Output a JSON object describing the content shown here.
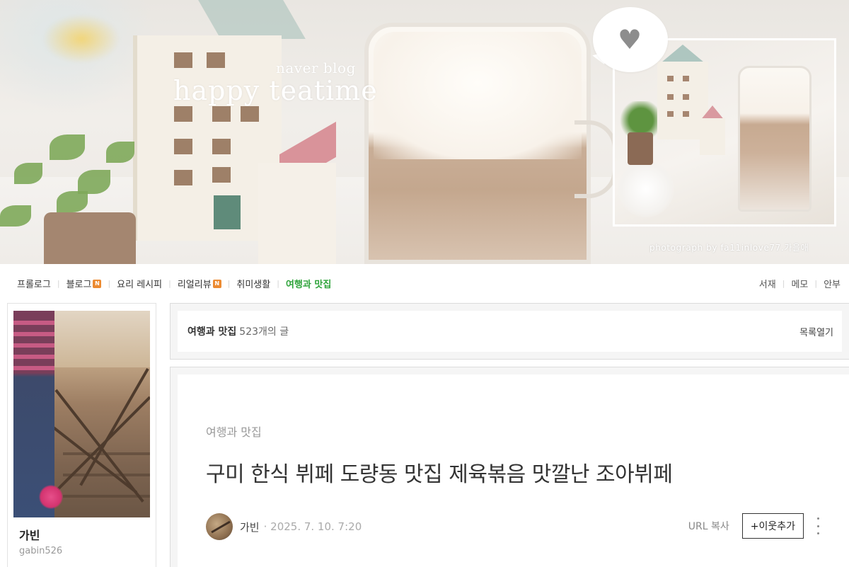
{
  "banner": {
    "subtitle": "naver blog",
    "title": "happy teatime",
    "credit": "photograph by fa11inlove77.가을애",
    "heart_icon": "heart-icon"
  },
  "menu": {
    "items": [
      {
        "label": "프롤로그",
        "badge": ""
      },
      {
        "label": "블로그",
        "badge": "N"
      },
      {
        "label": "요리 레시피",
        "badge": ""
      },
      {
        "label": "리얼리뷰",
        "badge": "N"
      },
      {
        "label": "취미생활",
        "badge": ""
      },
      {
        "label": "여행과 맛집",
        "badge": ""
      }
    ],
    "right_items": [
      "서재",
      "메모",
      "안부"
    ],
    "active_color": "#2ea33a",
    "badge_color": "#ec8b32"
  },
  "profile": {
    "name": "가빈",
    "id": "gabin526"
  },
  "category_bar": {
    "name": "여행과 맛집",
    "count": "523개의 글",
    "toggle": "목록열기"
  },
  "post": {
    "category": "여행과 맛집",
    "title": "구미 한식 뷔페 도량동 맛집 제육볶음 맛깔난 조아뷔페",
    "author": "가빈",
    "date": "· 2025. 7. 10. 7:20",
    "url_copy": "URL 복사",
    "neighbor_button": "+이웃추가"
  }
}
